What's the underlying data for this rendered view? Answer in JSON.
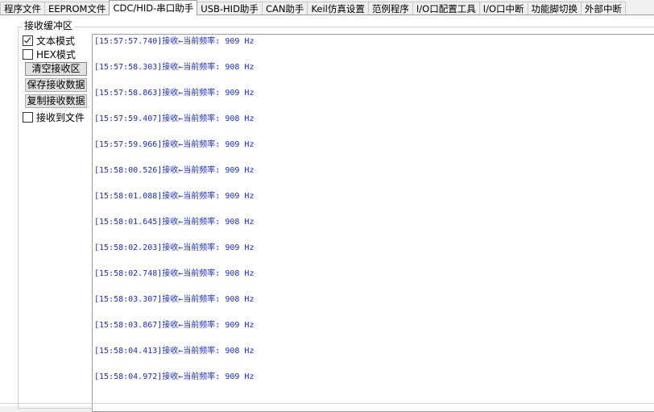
{
  "tabs": [
    {
      "label": "程序文件",
      "active": false
    },
    {
      "label": "EEPROM文件",
      "active": false
    },
    {
      "label": "CDC/HID-串口助手",
      "active": true
    },
    {
      "label": "USB-HID助手",
      "active": false
    },
    {
      "label": "CAN助手",
      "active": false
    },
    {
      "label": "Keil仿真设置",
      "active": false
    },
    {
      "label": "范例程序",
      "active": false
    },
    {
      "label": "I/O口配置工具",
      "active": false
    },
    {
      "label": "I/O口中断",
      "active": false
    },
    {
      "label": "功能脚切换",
      "active": false
    },
    {
      "label": "外部中断",
      "active": false
    }
  ],
  "receive": {
    "group_title": "接收缓冲区",
    "text_mode": {
      "label": "文本模式",
      "checked": true
    },
    "hex_mode": {
      "label": "HEX模式",
      "checked": false
    },
    "clear_button": "清空接收区",
    "save_button": "保存接收数据",
    "copy_button": "复制接收数据",
    "to_file": {
      "label": "接收到文件",
      "checked": false
    }
  },
  "log": [
    "[15:57:57.740]接收←当前频率: 909 Hz",
    "[15:57:58.303]接收←当前频率: 908 Hz",
    "[15:57:58.863]接收←当前频率: 909 Hz",
    "[15:57:59.407]接收←当前频率: 908 Hz",
    "[15:57:59.966]接收←当前频率: 909 Hz",
    "[15:58:00.526]接收←当前频率: 909 Hz",
    "[15:58:01.088]接收←当前频率: 909 Hz",
    "[15:58:01.645]接收←当前频率: 908 Hz",
    "[15:58:02.203]接收←当前频率: 909 Hz",
    "[15:58:02.748]接收←当前频率: 908 Hz",
    "[15:58:03.307]接收←当前频率: 908 Hz",
    "[15:58:03.867]接收←当前频率: 909 Hz",
    "[15:58:04.413]接收←当前频率: 908 Hz",
    "[15:58:04.972]接收←当前频率: 909 Hz"
  ]
}
